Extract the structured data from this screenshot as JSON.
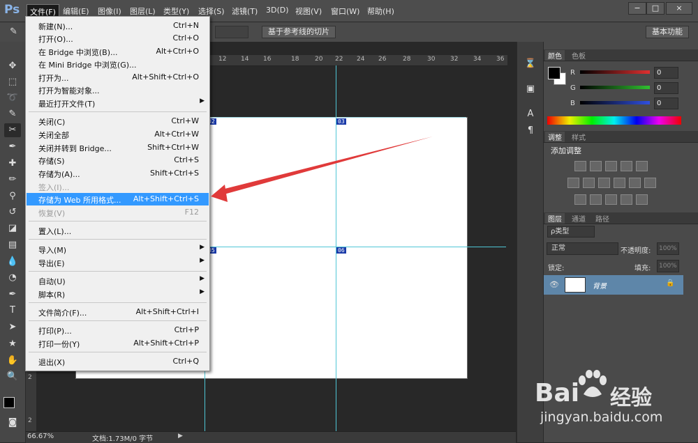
{
  "app": {
    "logo": "Ps"
  },
  "menubar": {
    "items": [
      "文件(F)",
      "编辑(E)",
      "图像(I)",
      "图层(L)",
      "类型(Y)",
      "选择(S)",
      "滤镜(T)",
      "3D(D)",
      "视图(V)",
      "窗口(W)",
      "帮助(H)"
    ],
    "window_buttons": [
      "−",
      "□",
      "×"
    ]
  },
  "optionsbar": {
    "slice_button": "基于参考线的切片",
    "workspace": "基本功能"
  },
  "file_menu": {
    "items": [
      {
        "label": "新建(N)...",
        "shortcut": "Ctrl+N"
      },
      {
        "label": "打开(O)...",
        "shortcut": "Ctrl+O"
      },
      {
        "label": "在 Bridge 中浏览(B)...",
        "shortcut": "Alt+Ctrl+O"
      },
      {
        "label": "在 Mini Bridge 中浏览(G)...",
        "shortcut": ""
      },
      {
        "label": "打开为...",
        "shortcut": "Alt+Shift+Ctrl+O"
      },
      {
        "label": "打开为智能对象...",
        "shortcut": ""
      },
      {
        "label": "最近打开文件(T)",
        "shortcut": "",
        "submenu": true
      },
      {
        "label": "关闭(C)",
        "shortcut": "Ctrl+W"
      },
      {
        "label": "关闭全部",
        "shortcut": "Alt+Ctrl+W"
      },
      {
        "label": "关闭并转到 Bridge...",
        "shortcut": "Shift+Ctrl+W"
      },
      {
        "label": "存储(S)",
        "shortcut": "Ctrl+S"
      },
      {
        "label": "存储为(A)...",
        "shortcut": "Shift+Ctrl+S"
      },
      {
        "label": "签入(I)...",
        "shortcut": "",
        "disabled": true
      },
      {
        "label": "存储为 Web 所用格式...",
        "shortcut": "Alt+Shift+Ctrl+S",
        "highlighted": true
      },
      {
        "label": "恢复(V)",
        "shortcut": "F12",
        "disabled": true
      },
      {
        "label": "置入(L)...",
        "shortcut": ""
      },
      {
        "label": "导入(M)",
        "shortcut": "",
        "submenu": true
      },
      {
        "label": "导出(E)",
        "shortcut": "",
        "submenu": true
      },
      {
        "label": "自动(U)",
        "shortcut": "",
        "submenu": true
      },
      {
        "label": "脚本(R)",
        "shortcut": "",
        "submenu": true
      },
      {
        "label": "文件简介(F)...",
        "shortcut": "Alt+Shift+Ctrl+I"
      },
      {
        "label": "打印(P)...",
        "shortcut": "Ctrl+P"
      },
      {
        "label": "打印一份(Y)",
        "shortcut": "Alt+Shift+Ctrl+P"
      },
      {
        "label": "退出(X)",
        "shortcut": "Ctrl+Q"
      }
    ]
  },
  "ruler": {
    "top_ticks": [
      "12",
      "14",
      "16",
      "18",
      "20",
      "22",
      "24",
      "26",
      "28",
      "30",
      "32",
      "34",
      "36"
    ],
    "left_ticks": [
      "2",
      "2"
    ]
  },
  "slices": [
    "02",
    "03",
    "05",
    "06"
  ],
  "status": {
    "zoom": "66.67%",
    "doc": "文档:1.73M/0 字节"
  },
  "color_panel": {
    "tabs": [
      "颜色",
      "色板"
    ],
    "channels": [
      {
        "label": "R",
        "value": "0",
        "color": "#e03030"
      },
      {
        "label": "G",
        "value": "0",
        "color": "#30c030"
      },
      {
        "label": "B",
        "value": "0",
        "color": "#3050e0"
      }
    ]
  },
  "adjust_panel": {
    "tabs": [
      "调整",
      "样式"
    ],
    "title": "添加调整"
  },
  "layers_panel": {
    "tabs": [
      "图层",
      "通道",
      "路径"
    ],
    "filter": "ρ类型",
    "blend_mode": "正常",
    "opacity_label": "不透明度:",
    "opacity_value": "100%",
    "lock_label": "锁定:",
    "fill_label": "填充:",
    "fill_value": "100%",
    "layer_name": "背景"
  },
  "watermark": {
    "brand": "Bai",
    "brand_cn": "经验",
    "url": "jingyan.baidu.com"
  },
  "colors": {
    "highlight": "#3399ff",
    "guide": "#4fc6d6",
    "arrow": "#e03a3a"
  }
}
